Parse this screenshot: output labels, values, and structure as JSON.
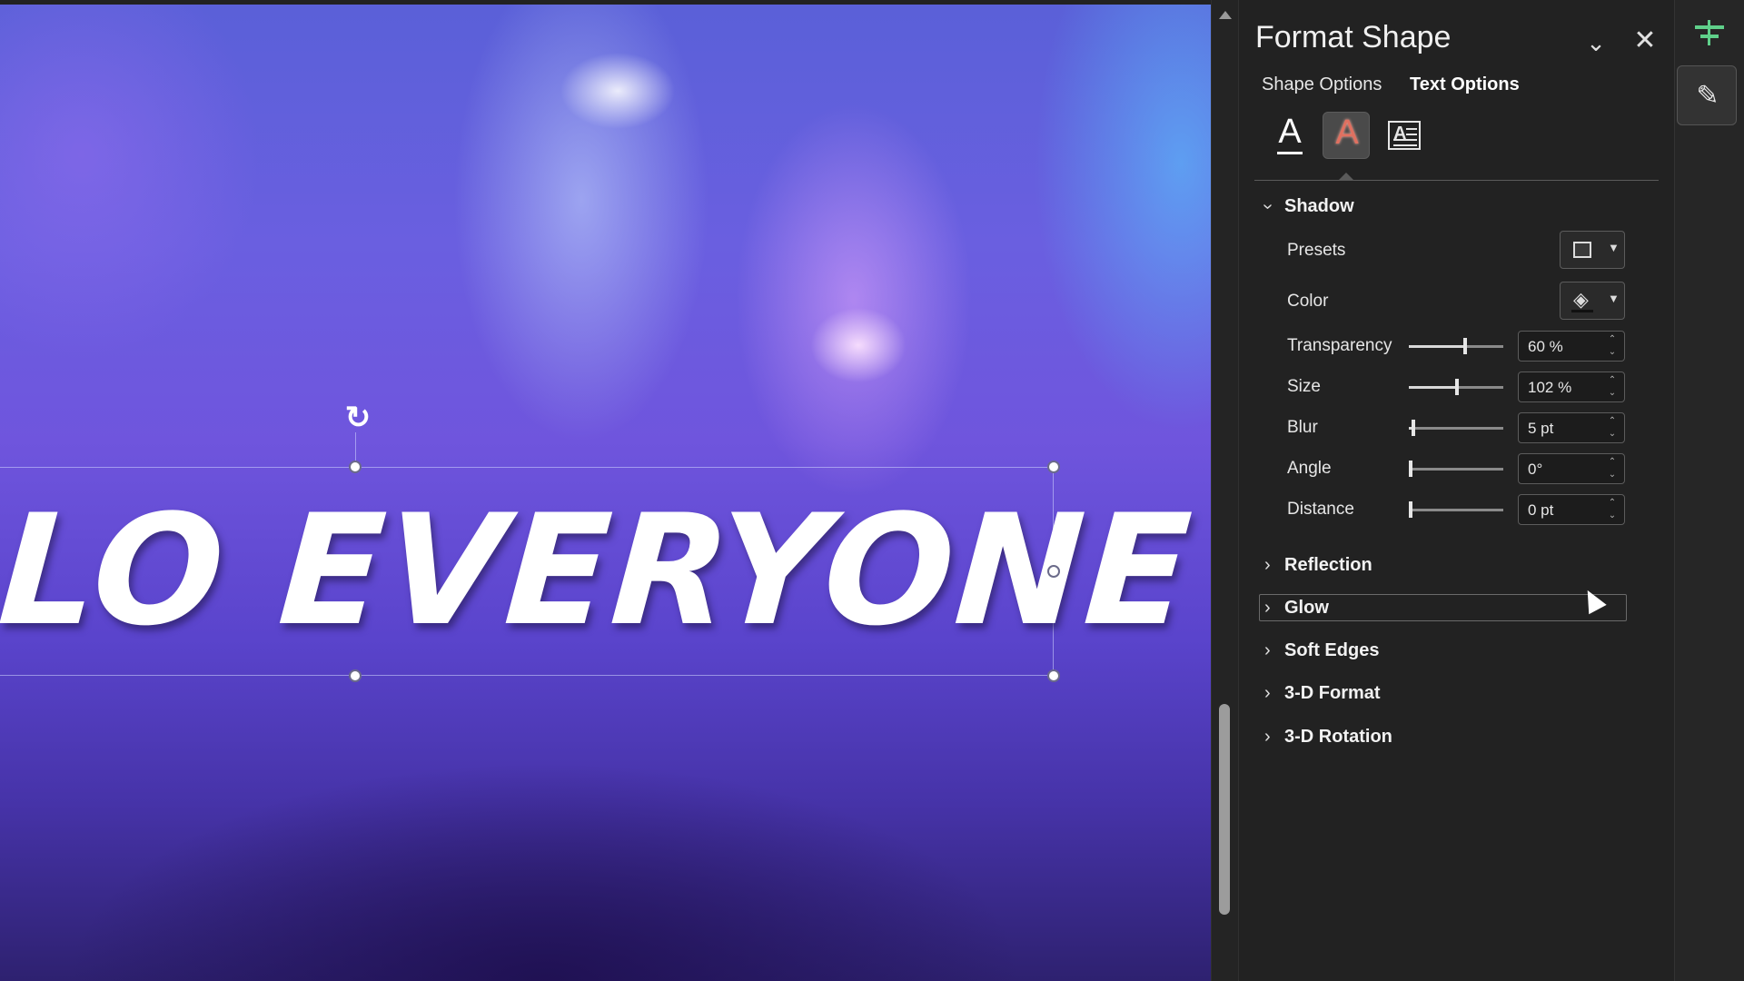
{
  "slide": {
    "text": "LO EVERYONE"
  },
  "pane": {
    "title": "Format Shape",
    "tabs": [
      {
        "label": "Shape Options",
        "active": false
      },
      {
        "label": "Text Options",
        "active": true
      }
    ],
    "icon_tabs": [
      "text-fill-outline-icon",
      "text-effects-icon",
      "textbox-icon"
    ],
    "icon_glyphs": {
      "fill": "A",
      "effects": "A",
      "layout": "A"
    },
    "shadow": {
      "label": "Shadow",
      "expanded": true,
      "presets_label": "Presets",
      "color_label": "Color",
      "fields": [
        {
          "label": "Transparency",
          "value": "60 %",
          "level": 0.6
        },
        {
          "label": "Size",
          "value": "102 %",
          "level": 0.51
        },
        {
          "label": "Blur",
          "value": "5 pt",
          "level": 0.05
        },
        {
          "label": "Angle",
          "value": "0°",
          "level": 0.0
        },
        {
          "label": "Distance",
          "value": "0 pt",
          "level": 0.0
        }
      ]
    },
    "sections": [
      {
        "label": "Reflection",
        "expanded": false
      },
      {
        "label": "Glow",
        "expanded": false,
        "hovered": true
      },
      {
        "label": "Soft Edges",
        "expanded": false
      },
      {
        "label": "3-D Format",
        "expanded": false
      },
      {
        "label": "3-D Rotation",
        "expanded": false
      }
    ]
  },
  "colors": {
    "accent_red": "#e07060",
    "strip_green": "#5fd08a"
  }
}
